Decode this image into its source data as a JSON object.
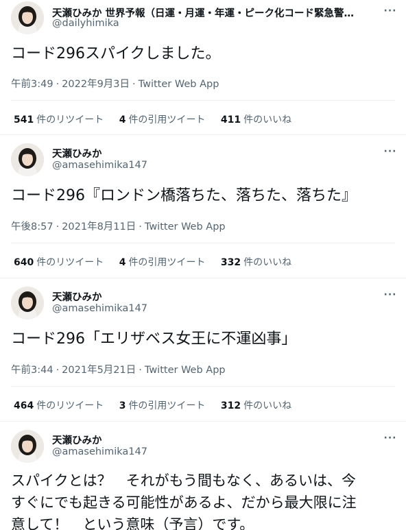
{
  "tweets": [
    {
      "display_name": "天瀬ひみか 世界予報（日運・月運・年運・ピーク化コード緊急警…",
      "handle": "@dailyhimika",
      "text": "コード296スパイクしました。",
      "time": "午前3:49",
      "date": "2022年9月3日",
      "source": "Twitter Web App",
      "retweets": "541",
      "retweets_label": "件のリツイート",
      "quotes": "4",
      "quotes_label": "件の引用ツイート",
      "likes": "411",
      "likes_label": "件のいいね"
    },
    {
      "display_name": "天瀬ひみか",
      "handle": "@amasehimika147",
      "text": "コード296『ロンドン橋落ちた、落ちた、落ちた』",
      "time": "午後8:57",
      "date": "2021年8月11日",
      "source": "Twitter Web App",
      "retweets": "640",
      "retweets_label": "件のリツイート",
      "quotes": "4",
      "quotes_label": "件の引用ツイート",
      "likes": "332",
      "likes_label": "件のいいね"
    },
    {
      "display_name": "天瀬ひみか",
      "handle": "@amasehimika147",
      "text": "コード296「エリザベス女王に不運凶事」",
      "time": "午前3:44",
      "date": "2021年5月21日",
      "source": "Twitter Web App",
      "retweets": "464",
      "retweets_label": "件のリツイート",
      "quotes": "3",
      "quotes_label": "件の引用ツイート",
      "likes": "312",
      "likes_label": "件のいいね"
    },
    {
      "display_name": "天瀬ひみか",
      "handle": "@amasehimika147",
      "text_line1": "スパイクとは？　それがもう間もなく、あるいは、今",
      "text_line2": "すぐにでも起きる可能性があるよ、だから最大限に注",
      "text_line3": "意して！　という意味（予言）です。"
    }
  ],
  "more_glyph": "···",
  "meta_separator": "·",
  "icons": {
    "avatar": "avatar-photo",
    "more": "more-options-icon"
  }
}
